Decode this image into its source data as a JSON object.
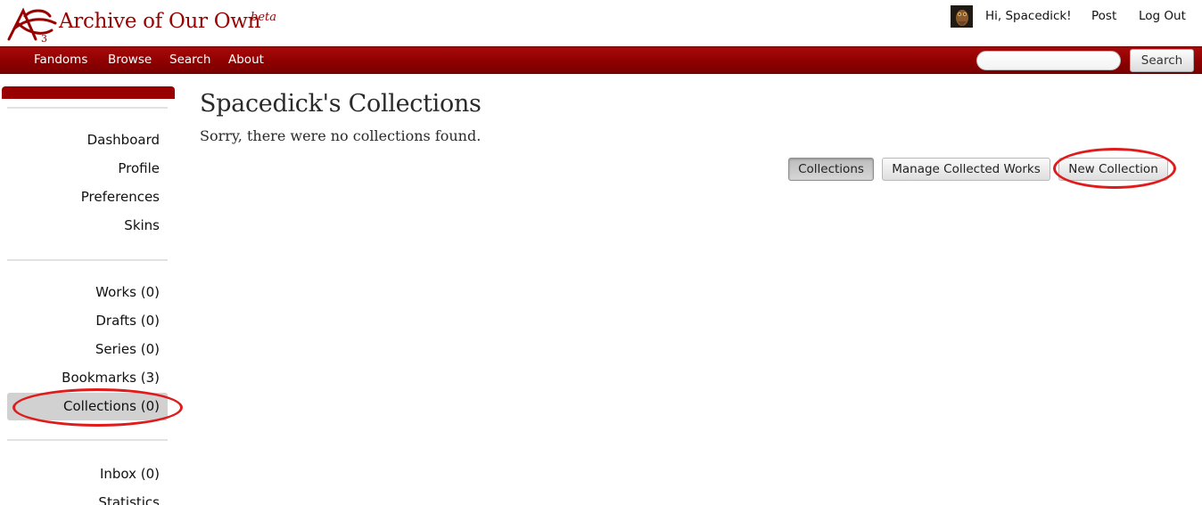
{
  "header": {
    "site_title": "Archive of Our Own",
    "site_beta": "beta",
    "greeting": "Hi, Spacedick!",
    "post_link": "Post",
    "logout_link": "Log Out"
  },
  "nav": {
    "items": [
      "Fandoms",
      "Browse",
      "Search",
      "About"
    ],
    "search_placeholder": "",
    "search_button": "Search"
  },
  "sidebar": {
    "group1": [
      "Dashboard",
      "Profile",
      "Preferences",
      "Skins"
    ],
    "group2": [
      "Works (0)",
      "Drafts (0)",
      "Series (0)",
      "Bookmarks (3)",
      "Collections (0)"
    ],
    "group3": [
      "Inbox (0)",
      "Statistics"
    ],
    "current": "Collections (0)"
  },
  "main": {
    "title": "Spacedick's Collections",
    "empty_message": "Sorry, there were no collections found.",
    "actions": [
      "Collections",
      "Manage Collected Works",
      "New Collection"
    ],
    "current_action": "Collections"
  },
  "colors": {
    "brand": "#990000",
    "highlight": "#e01b1b"
  }
}
